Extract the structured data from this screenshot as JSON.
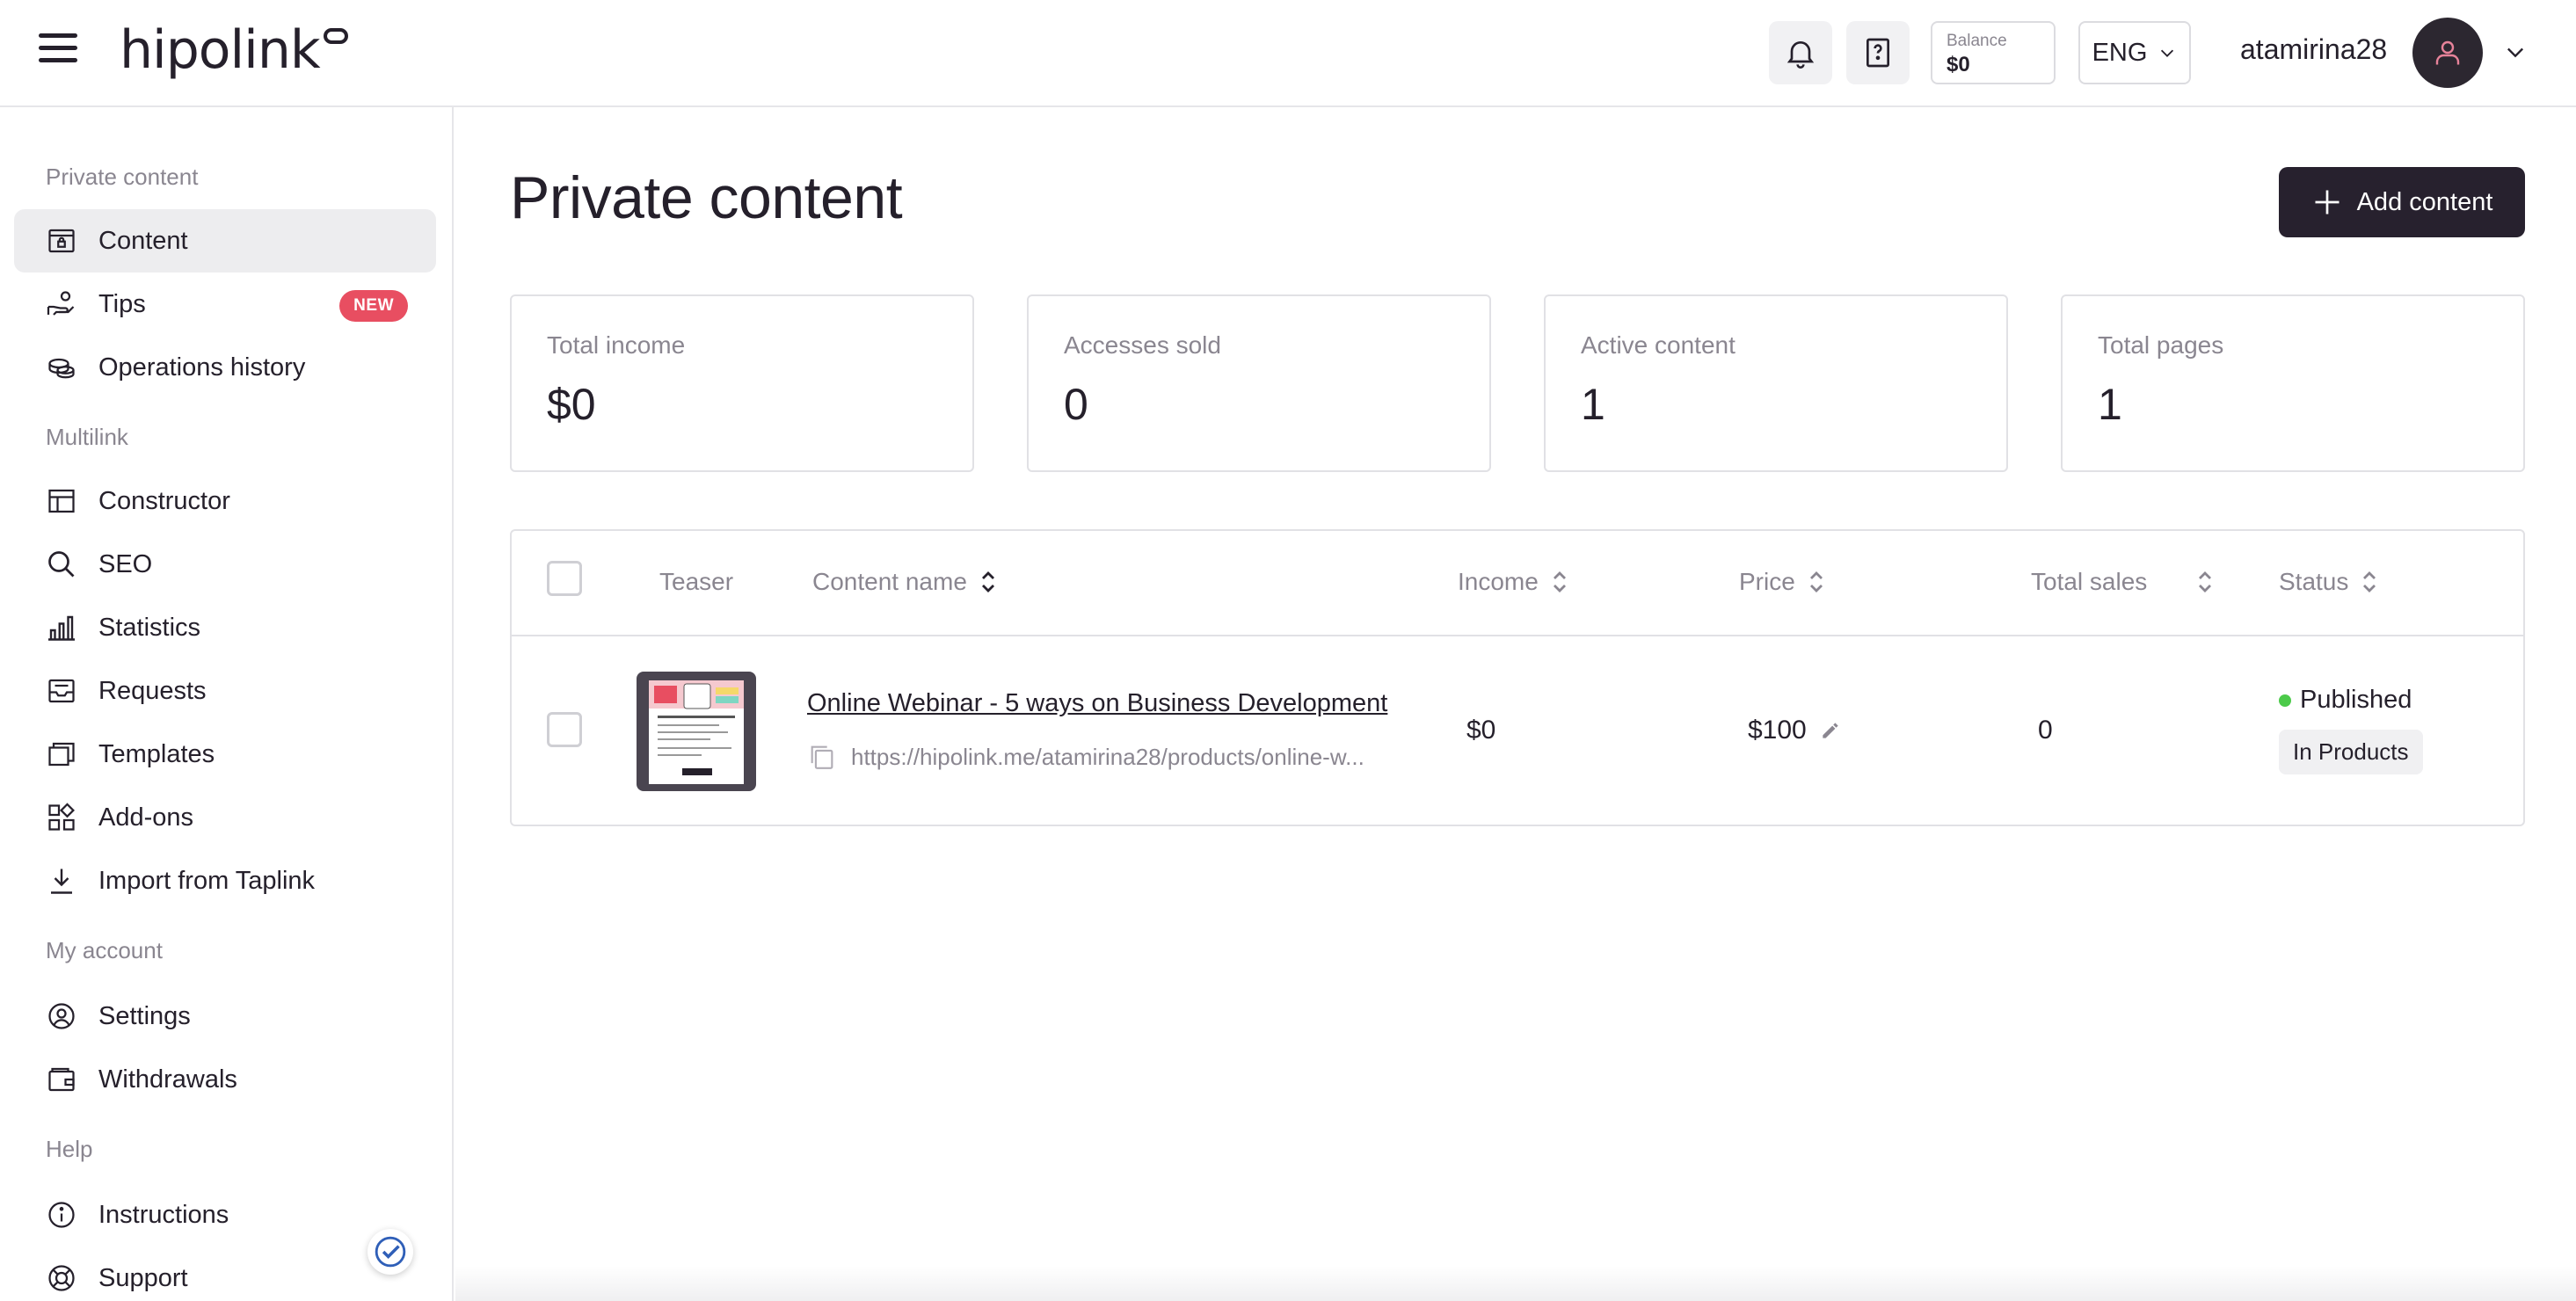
{
  "header": {
    "logo_text": "hipolink",
    "balance_label": "Balance",
    "balance_value": "$0",
    "language": "ENG",
    "username": "atamirina28"
  },
  "sidebar": {
    "sections": [
      {
        "title": "Private content",
        "items": [
          {
            "label": "Content",
            "icon": "content-lock-icon",
            "active": true
          },
          {
            "label": "Tips",
            "icon": "hand-coins-icon",
            "badge": "NEW"
          },
          {
            "label": "Operations history",
            "icon": "coins-icon"
          }
        ]
      },
      {
        "title": "Multilink",
        "items": [
          {
            "label": "Constructor",
            "icon": "layout-icon"
          },
          {
            "label": "SEO",
            "icon": "search-icon"
          },
          {
            "label": "Statistics",
            "icon": "bar-chart-icon"
          },
          {
            "label": "Requests",
            "icon": "inbox-icon"
          },
          {
            "label": "Templates",
            "icon": "templates-icon"
          },
          {
            "label": "Add-ons",
            "icon": "addons-grid-icon"
          },
          {
            "label": "Import from Taplink",
            "icon": "download-icon"
          }
        ]
      },
      {
        "title": "My account",
        "items": [
          {
            "label": "Settings",
            "icon": "gear-user-icon"
          },
          {
            "label": "Withdrawals",
            "icon": "wallet-icon"
          }
        ]
      },
      {
        "title": "Help",
        "items": [
          {
            "label": "Instructions",
            "icon": "info-icon"
          },
          {
            "label": "Support",
            "icon": "lifebuoy-icon"
          }
        ]
      }
    ]
  },
  "main": {
    "title": "Private content",
    "add_button_label": "Add content",
    "stats": [
      {
        "label": "Total income",
        "value": "$0"
      },
      {
        "label": "Accesses sold",
        "value": "0"
      },
      {
        "label": "Active content",
        "value": "1"
      },
      {
        "label": "Total pages",
        "value": "1"
      }
    ],
    "table": {
      "columns": [
        "Teaser",
        "Content name",
        "Income",
        "Price",
        "Total sales",
        "Status"
      ],
      "rows": [
        {
          "name": "Online Webinar - 5 ways on Business Development",
          "url": "https://hipolink.me/atamirina28/products/online-w...",
          "income": "$0",
          "price": "$100",
          "total_sales": "0",
          "status": "Published",
          "status_tag": "In Products"
        }
      ]
    }
  },
  "colors": {
    "primary_dark": "#27212e",
    "badge_red": "#e84e61",
    "status_green": "#4cca4a",
    "muted_text": "#8a8690"
  }
}
